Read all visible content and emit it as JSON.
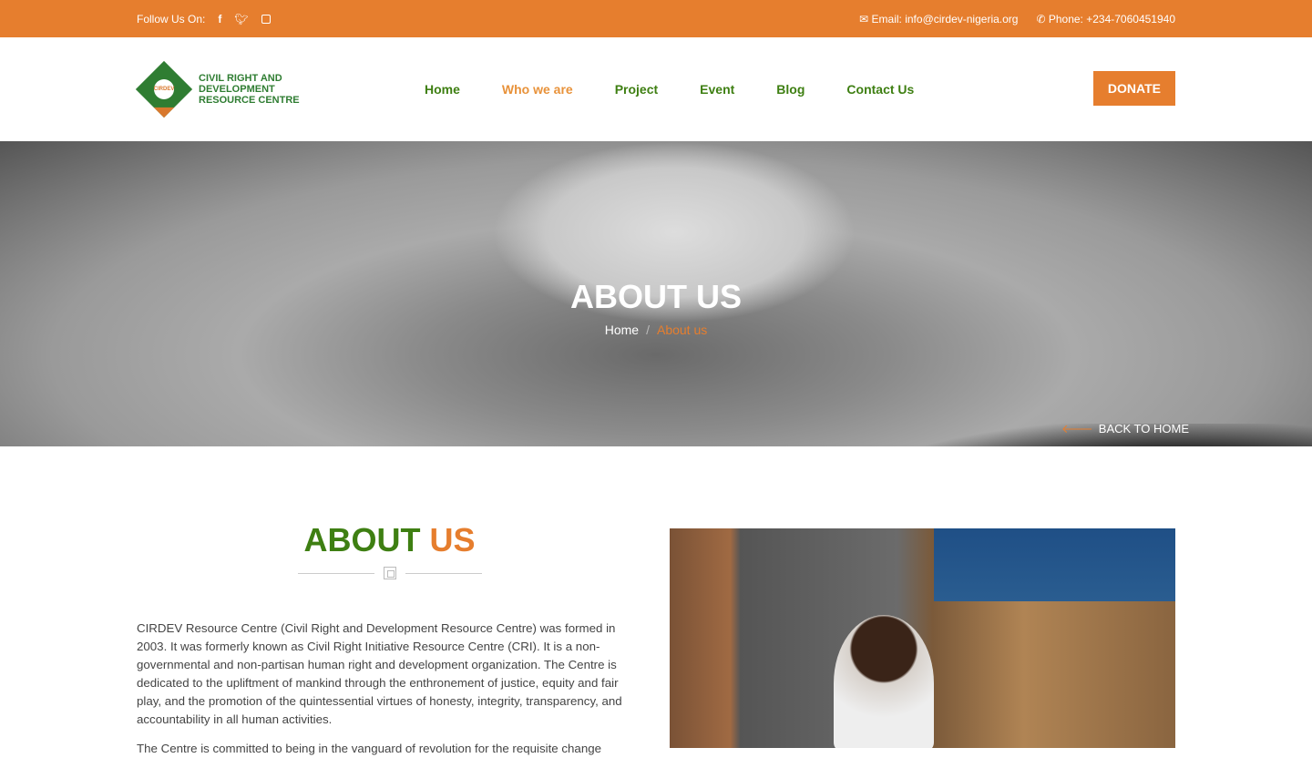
{
  "topbar": {
    "follow": "Follow Us On:",
    "social": [
      "facebook-icon",
      "twitter-icon",
      "instagram-icon"
    ],
    "email": "Email: info@cirdev-nigeria.org",
    "phone": "Phone: +234-7060451940"
  },
  "logo": {
    "text1": "CIVIL RIGHT AND",
    "text2": "DEVELOPMENT",
    "text3": "RESOURCE CENTRE",
    "badge": "CIRDEV"
  },
  "nav": [
    {
      "label": "Home"
    },
    {
      "label": "Who we are",
      "active": true
    },
    {
      "label": "Project"
    },
    {
      "label": "Event"
    },
    {
      "label": "Blog"
    },
    {
      "label": "Contact Us"
    }
  ],
  "donate": "DONATE",
  "hero": {
    "title": "ABOUT US",
    "crumb_home": "Home",
    "crumb_sep": "/",
    "crumb_current": "About us",
    "back": "BACK TO HOME"
  },
  "about": {
    "title_a": "ABOUT",
    "title_b": "US",
    "p1": "CIRDEV Resource Centre (Civil Right and Development Resource Centre) was formed in 2003. It was formerly known as Civil Right Initiative Resource Centre (CRI). It is a non-governmental and non-partisan human right and development organization. The Centre is dedicated to the upliftment of mankind through the enthronement of justice, equity and fair play, and the promotion of the quintessential virtues of honesty, integrity, transparency, and accountability in all human activities.",
    "p2": "The Centre is committed to being in the vanguard of revolution for the requisite change"
  },
  "colors": {
    "accent": "#e67e2e",
    "green": "#3e7f12"
  }
}
